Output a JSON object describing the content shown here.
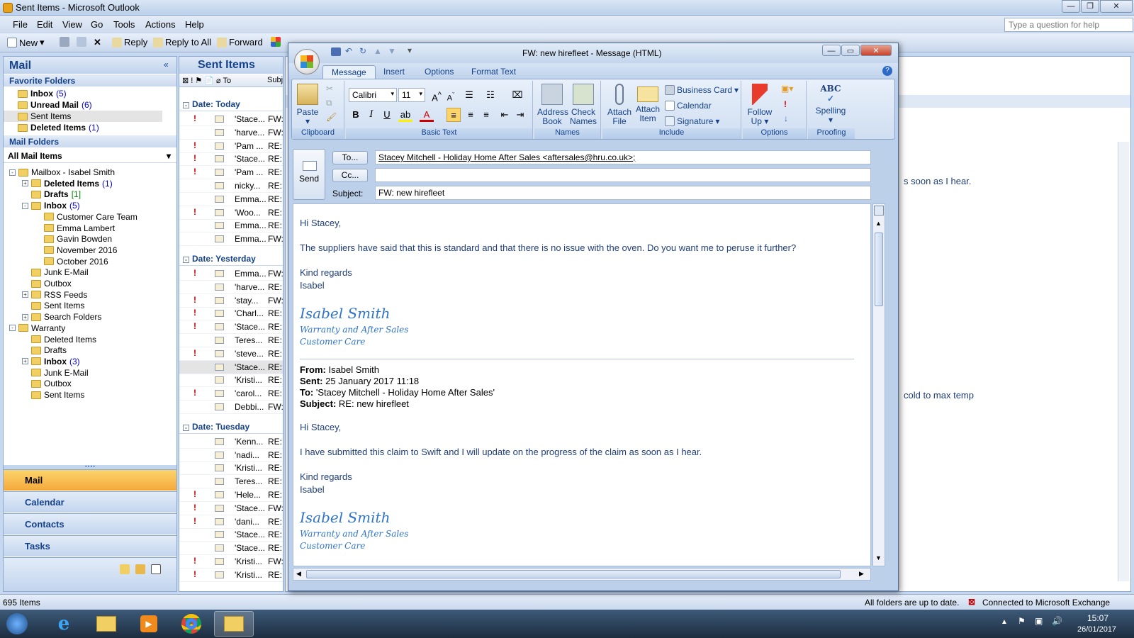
{
  "app": {
    "title": "Sent Items - Microsoft Outlook",
    "help_placeholder": "Type a question for help"
  },
  "menu": [
    "File",
    "Edit",
    "View",
    "Go",
    "Tools",
    "Actions",
    "Help"
  ],
  "toolbar": {
    "new": "New",
    "reply": "Reply",
    "reply_all": "Reply to All",
    "forward": "Forward"
  },
  "nav": {
    "title": "Mail",
    "favorites_title": "Favorite Folders",
    "favorites": [
      {
        "label": "Inbox",
        "count": "(5)",
        "bold": true
      },
      {
        "label": "Unread Mail",
        "count": "(6)",
        "bold": true
      },
      {
        "label": "Sent Items",
        "count": "",
        "bold": false,
        "selected": true
      },
      {
        "label": "Deleted Items",
        "count": "(1)",
        "bold": true
      }
    ],
    "mail_folders_title": "Mail Folders",
    "all_items": "All Mail Items",
    "tree": [
      {
        "label": "Mailbox - Isabel Smith",
        "indent": 0,
        "pm": "-"
      },
      {
        "label": "Deleted Items",
        "count": "(1)",
        "indent": 1,
        "pm": "+",
        "bold": true
      },
      {
        "label": "Drafts",
        "count": "[1]",
        "indent": 1,
        "bold": true,
        "green": true
      },
      {
        "label": "Inbox",
        "count": "(5)",
        "indent": 1,
        "pm": "-",
        "bold": true
      },
      {
        "label": "Customer Care Team",
        "indent": 2
      },
      {
        "label": "Emma Lambert",
        "indent": 2
      },
      {
        "label": "Gavin Bowden",
        "indent": 2
      },
      {
        "label": "November 2016",
        "indent": 2
      },
      {
        "label": "October 2016",
        "indent": 2
      },
      {
        "label": "Junk E-Mail",
        "indent": 1
      },
      {
        "label": "Outbox",
        "indent": 1
      },
      {
        "label": "RSS Feeds",
        "indent": 1,
        "pm": "+"
      },
      {
        "label": "Sent Items",
        "indent": 1
      },
      {
        "label": "Search Folders",
        "indent": 1,
        "pm": "+"
      },
      {
        "label": "Warranty",
        "indent": 0,
        "pm": "-"
      },
      {
        "label": "Deleted Items",
        "indent": 1
      },
      {
        "label": "Drafts",
        "indent": 1
      },
      {
        "label": "Inbox",
        "count": "(3)",
        "indent": 1,
        "pm": "+",
        "bold": true
      },
      {
        "label": "Junk E-Mail",
        "indent": 1
      },
      {
        "label": "Outbox",
        "indent": 1
      },
      {
        "label": "Sent Items",
        "indent": 1
      }
    ],
    "buttons": [
      "Mail",
      "Calendar",
      "Contacts",
      "Tasks"
    ]
  },
  "list": {
    "title": "Sent Items",
    "col_to": "To",
    "col_subj": "Subj",
    "groups": [
      {
        "label": "Date: Today",
        "rows": [
          {
            "imp": true,
            "who": "'Stace...",
            "subj": "FW:"
          },
          {
            "imp": false,
            "who": "'harve...",
            "subj": "FW:"
          },
          {
            "imp": true,
            "who": "'Pam ...",
            "subj": "RE:"
          },
          {
            "imp": true,
            "who": "'Stace...",
            "subj": "RE:"
          },
          {
            "imp": true,
            "who": "'Pam ...",
            "subj": "RE:"
          },
          {
            "imp": false,
            "who": "nicky...",
            "subj": "RE:"
          },
          {
            "imp": false,
            "who": "Emma...",
            "subj": "RE:"
          },
          {
            "imp": true,
            "who": "'Woo...",
            "subj": "RE:"
          },
          {
            "imp": false,
            "who": "Emma...",
            "subj": "RE:"
          },
          {
            "imp": false,
            "who": "Emma...",
            "subj": "FW:"
          }
        ]
      },
      {
        "label": "Date: Yesterday",
        "rows": [
          {
            "imp": true,
            "who": "Emma...",
            "subj": "FW:"
          },
          {
            "imp": false,
            "who": "'harve...",
            "subj": "RE:"
          },
          {
            "imp": true,
            "who": "'stay...",
            "subj": "FW:"
          },
          {
            "imp": true,
            "who": "'Charl...",
            "subj": "RE:"
          },
          {
            "imp": true,
            "who": "'Stace...",
            "subj": "RE:"
          },
          {
            "imp": false,
            "who": "Teres...",
            "subj": "RE:"
          },
          {
            "imp": true,
            "who": "'steve...",
            "subj": "RE:"
          },
          {
            "imp": false,
            "who": "'Stace...",
            "subj": "RE:",
            "sel": true
          },
          {
            "imp": false,
            "who": "'Kristi...",
            "subj": "RE:"
          },
          {
            "imp": true,
            "who": "'carol...",
            "subj": "RE:"
          },
          {
            "imp": false,
            "who": "Debbi...",
            "subj": "FW:"
          }
        ]
      },
      {
        "label": "Date: Tuesday",
        "rows": [
          {
            "imp": false,
            "who": "'Kenn...",
            "subj": "RE:"
          },
          {
            "imp": false,
            "who": "'nadi...",
            "subj": "RE:"
          },
          {
            "imp": false,
            "who": "'Kristi...",
            "subj": "RE:"
          },
          {
            "imp": false,
            "who": "Teres...",
            "subj": "RE:"
          },
          {
            "imp": true,
            "who": "'Hele...",
            "subj": "RE:"
          },
          {
            "imp": true,
            "who": "'Stace...",
            "subj": "FW:"
          },
          {
            "imp": true,
            "who": "'dani...",
            "subj": "RE:"
          },
          {
            "imp": false,
            "who": "'Stace...",
            "subj": "RE:"
          },
          {
            "imp": false,
            "who": "'Stace...",
            "subj": "RE:"
          },
          {
            "imp": true,
            "who": "'Kristi...",
            "subj": "FW:"
          },
          {
            "imp": true,
            "who": "'Kristi...",
            "subj": "RE:"
          }
        ]
      }
    ]
  },
  "reading": {
    "frag1": "s soon as I hear.",
    "frag2": "cold to max temp"
  },
  "status": {
    "items": "695 Items",
    "sync": "All folders are up to date.",
    "connection": "Connected to Microsoft Exchange"
  },
  "taskbar": {
    "time": "15:07",
    "date": "26/01/2017"
  },
  "message": {
    "title": "FW: new hirefleet - Message (HTML)",
    "tabs": [
      "Message",
      "Insert",
      "Options",
      "Format Text"
    ],
    "ribbon": {
      "paste": "Paste",
      "clipboard": "Clipboard",
      "font": "Calibri",
      "size": "11",
      "basic_text": "Basic Text",
      "address_book": "Address Book",
      "check_names": "Check Names",
      "names": "Names",
      "attach_file": "Attach File",
      "attach_item": "Attach Item",
      "business_card": "Business Card",
      "calendar": "Calendar",
      "signature": "Signature",
      "include": "Include",
      "follow_up": "Follow Up",
      "options": "Options",
      "spelling": "Spelling",
      "proofing": "Proofing"
    },
    "send": "Send",
    "to_btn": "To...",
    "cc_btn": "Cc...",
    "subject_label": "Subject:",
    "to": "Stacey Mitchell - Holiday Home After Sales <aftersales@hru.co.uk>;",
    "cc": "",
    "subject": "FW: new hirefleet",
    "body": {
      "greeting": "Hi Stacey,",
      "para": "The suppliers have said that this is standard and that there is no issue with the oven. Do you want me to peruse it further?",
      "regards": "Kind regards",
      "name": "Isabel",
      "sig_name": "Isabel Smith",
      "sig_line1": "Warranty and After Sales",
      "sig_line2": "Customer Care",
      "from_label": "From:",
      "from": "Isabel Smith",
      "sent_label": "Sent:",
      "sent": "25 January 2017 11:18",
      "to_label": "To:",
      "to": "'Stacey Mitchell - Holiday Home After Sales'",
      "subject_label": "Subject:",
      "subject": "RE: new hirefleet",
      "greeting2": "Hi Stacey,",
      "para2": "I have submitted this claim to Swift and I will update on the progress of the claim as soon as I hear.",
      "regards2": "Kind regards",
      "name2": "Isabel",
      "sig_name2": "Isabel Smith",
      "sig2_line1": "Warranty and After Sales",
      "sig2_line2": "Customer Care"
    }
  }
}
